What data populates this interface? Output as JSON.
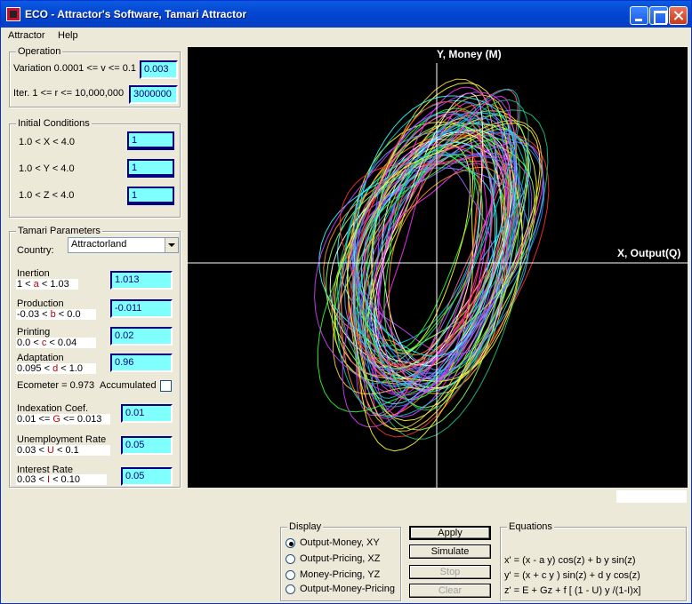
{
  "window": {
    "title": "ECO - Attractor's Software, Tamari Attractor"
  },
  "menu": {
    "items": [
      "Attractor",
      "Help"
    ]
  },
  "operation": {
    "legend": "Operation",
    "variation_label": "Variation  0.0001 <= v <= 0.1",
    "variation_value": "0.003",
    "iter_label": "Iter. 1 <= r <= 10,000,000",
    "iter_value": "3000000"
  },
  "initial_conditions": {
    "legend": "Initial Conditions",
    "x_label": "1.0  <  X  < 4.0",
    "x_value": "1",
    "y_label": "1.0  <  Y  < 4.0",
    "y_value": "1",
    "z_label": "1.0  <  Z  < 4.0",
    "z_value": "1"
  },
  "tamari": {
    "legend": "Tamari Parameters",
    "country_label": "Country:",
    "country_value": "Attractorland",
    "inertion": {
      "name": "Inertion",
      "pre": "1 < ",
      "sym": "a",
      "post": " < 1.03",
      "value": "1.013"
    },
    "production": {
      "name": "Production",
      "pre": "-0.03 < ",
      "sym": "b",
      "post": " < 0.0",
      "value": "-0.011"
    },
    "printing": {
      "name": "Printing",
      "pre": "0.0 < ",
      "sym": "c",
      "post": " < 0.04",
      "value": "0.02"
    },
    "adaptation": {
      "name": "Adaptation",
      "pre": "0.095 < ",
      "sym": "d",
      "post": " < 1.0",
      "value": "0.96"
    },
    "ecometer": "Ecometer = 0.973",
    "accumulated": "Accumulated",
    "indexation": {
      "name": "Indexation Coef.",
      "pre": "0.01 <= ",
      "sym": "G",
      "post": "  <=  0.013",
      "value": "0.01"
    },
    "unemployment": {
      "name": "Unemployment Rate",
      "pre": "0.03 < ",
      "sym": "U",
      "post": " < 0.1",
      "value": "0.05"
    },
    "interest": {
      "name": "Interest Rate",
      "pre": "0.03 < ",
      "sym": "I",
      "post": " < 0.10",
      "value": "0.05"
    }
  },
  "plot": {
    "y_axis": "Y, Money (M)",
    "x_axis": "X, Output(Q)"
  },
  "display": {
    "legend": "Display",
    "options": [
      "Output-Money, XY",
      "Output-Pricing, XZ",
      "Money-Pricing, YZ",
      "Output-Money-Pricing"
    ],
    "selected": 0
  },
  "buttons": {
    "apply": "Apply",
    "simulate": "Simulate",
    "stop": "Stop",
    "clear": "Clear"
  },
  "equations": {
    "legend": "Equations",
    "x": "x' = (x - a y) cos(z) + b y sin(z)",
    "y": "y' =  (x + c y ) sin(z) + d y cos(z)",
    "z": "z' =  E + Gz + f [ (1 - U) y /(1-I)x]"
  },
  "colors": {
    "plot_bg": "#000000",
    "field_bg": "#80ffff",
    "field_text": "#000080",
    "title_bar": "#0548d4"
  }
}
